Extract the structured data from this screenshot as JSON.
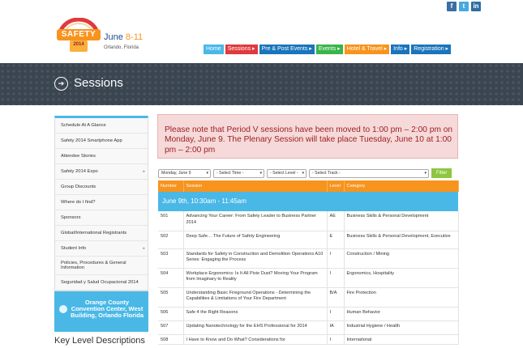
{
  "social": [
    {
      "icon": "facebook-icon",
      "glyph": "f"
    },
    {
      "icon": "twitter-icon",
      "glyph": "t"
    },
    {
      "icon": "linkedin-icon",
      "glyph": "in"
    }
  ],
  "brand": {
    "logo_text": "SAFETY",
    "logo_year": "2014",
    "month": "June",
    "days": "8-11",
    "city": "Orlando, Florida"
  },
  "nav": [
    {
      "label": "Home",
      "color": "#4ab8e6"
    },
    {
      "label": "Sessions ▸",
      "color": "#e03a3e"
    },
    {
      "label": "Pre & Post Events ▸",
      "color": "#1a75bb"
    },
    {
      "label": "Events ▸",
      "color": "#39b54a"
    },
    {
      "label": "Hotel & Travel ▸",
      "color": "#f7941d"
    },
    {
      "label": "Info ▸",
      "color": "#1a75bb"
    },
    {
      "label": "Registration ▸",
      "color": "#1a75bb"
    }
  ],
  "hero": {
    "title": "Sessions"
  },
  "sidebar": {
    "items": [
      {
        "label": "Schedule At A Glance",
        "caret": false,
        "h": 19
      },
      {
        "label": "Safety 2014 Smartphone App",
        "caret": false,
        "h": 19
      },
      {
        "label": "Attendee Stories",
        "caret": false,
        "h": 19
      },
      {
        "label": "Safety 2014 Expo",
        "caret": true,
        "h": 19
      },
      {
        "label": "Group Discounts",
        "caret": false,
        "h": 19
      },
      {
        "label": "Where do I find?",
        "caret": false,
        "h": 19
      },
      {
        "label": "Sponsors",
        "caret": false,
        "h": 19
      },
      {
        "label": "Global/International Registrants",
        "caret": false,
        "h": 19
      },
      {
        "label": "Student Info",
        "caret": true,
        "h": 19
      },
      {
        "label": "Policies, Procedures & General Information",
        "caret": false,
        "h": 23
      },
      {
        "label": "Seguridad y Salud Ocupacional 2014",
        "caret": false,
        "h": 19
      }
    ],
    "location": "Orange County Convention Center, West Building, Orlando Florida",
    "key_title": "Key Level Descriptions"
  },
  "notice": "Please note that Period V sessions have been moved to 1:00 pm – 2:00 pm on Monday, June 9. The Plenary Session will take place Tuesday, June 10 at 1:00 pm – 2:00 pm",
  "filters": {
    "day": "Monday, June 9",
    "time": "- Select Time -",
    "level": "- Select Level -",
    "track": "- Select Track -",
    "button": "Filter"
  },
  "table": {
    "headers": [
      "Number",
      "Session",
      "Level",
      "Category"
    ],
    "band": "June 9th, 10:30am - 11:45am",
    "rows": [
      {
        "num": "501",
        "session": "Advancing Your Career: From Safety Leader to Business Partner 2014",
        "level": "AE",
        "cat": "Business Skills & Personal Development"
      },
      {
        "num": "502",
        "session": "Deep Safe… The Future of Safety Engineering",
        "level": "E",
        "cat": "Business Skills & Personal Development, Executive"
      },
      {
        "num": "503",
        "session": "Standards for Safety in Construction and Demolition Operations A10 Series: Engaging the Process",
        "level": "I",
        "cat": "Construction / Mining"
      },
      {
        "num": "504",
        "session": "Workplace Ergonomics: Is It All Pixie Dust? Moving Your Program from Imaginary to Reality",
        "level": "I",
        "cat": "Ergonomics, Hospitality"
      },
      {
        "num": "505",
        "session": "Understanding Basic Fireground Operations - Determining the Capabilities & Limitations of Your Fire Department",
        "level": "B/A",
        "cat": "Fire Protection"
      },
      {
        "num": "506",
        "session": "Safe 4 the Right Reasons",
        "level": "I",
        "cat": "Human Behavior"
      },
      {
        "num": "507",
        "session": "Updating Nanotechnology for the EHS Professional for 2014",
        "level": "IA",
        "cat": "Industrial Hygiene / Health"
      },
      {
        "num": "508",
        "session": "I Have to Know and Do What? Considerations for",
        "level": "I",
        "cat": "International"
      }
    ]
  }
}
